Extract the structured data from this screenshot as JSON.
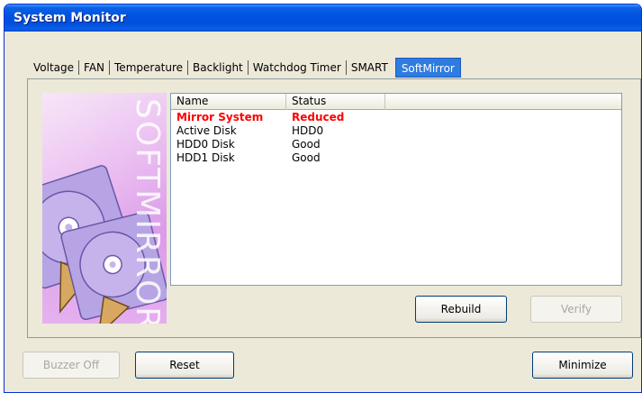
{
  "window": {
    "title": "System Monitor"
  },
  "tabs": [
    {
      "label": "Voltage"
    },
    {
      "label": "FAN"
    },
    {
      "label": "Temperature"
    },
    {
      "label": "Backlight"
    },
    {
      "label": "Watchdog Timer"
    },
    {
      "label": "SMART"
    },
    {
      "label": "SoftMirror",
      "active": true
    }
  ],
  "brand": {
    "text": "SOFTMIRROR",
    "colors": {
      "background": "#e8b6ef",
      "disk": "#c7b3ec",
      "stand": "#d8a860"
    }
  },
  "list": {
    "columns": [
      "Name",
      "Status"
    ],
    "rows": [
      {
        "name": "Mirror System",
        "status": "Reduced",
        "alert": true
      },
      {
        "name": "Active Disk",
        "status": "HDD0"
      },
      {
        "name": "HDD0 Disk",
        "status": "Good"
      },
      {
        "name": "HDD1 Disk",
        "status": "Good"
      }
    ]
  },
  "panel_buttons": {
    "rebuild": "Rebuild",
    "verify": "Verify"
  },
  "footer_buttons": {
    "buzzer_off": "Buzzer Off",
    "reset": "Reset",
    "minimize": "Minimize"
  },
  "colors": {
    "titlebar": "#0052e0",
    "alert_text": "#ff0000",
    "active_tab": "#2f7be0"
  }
}
